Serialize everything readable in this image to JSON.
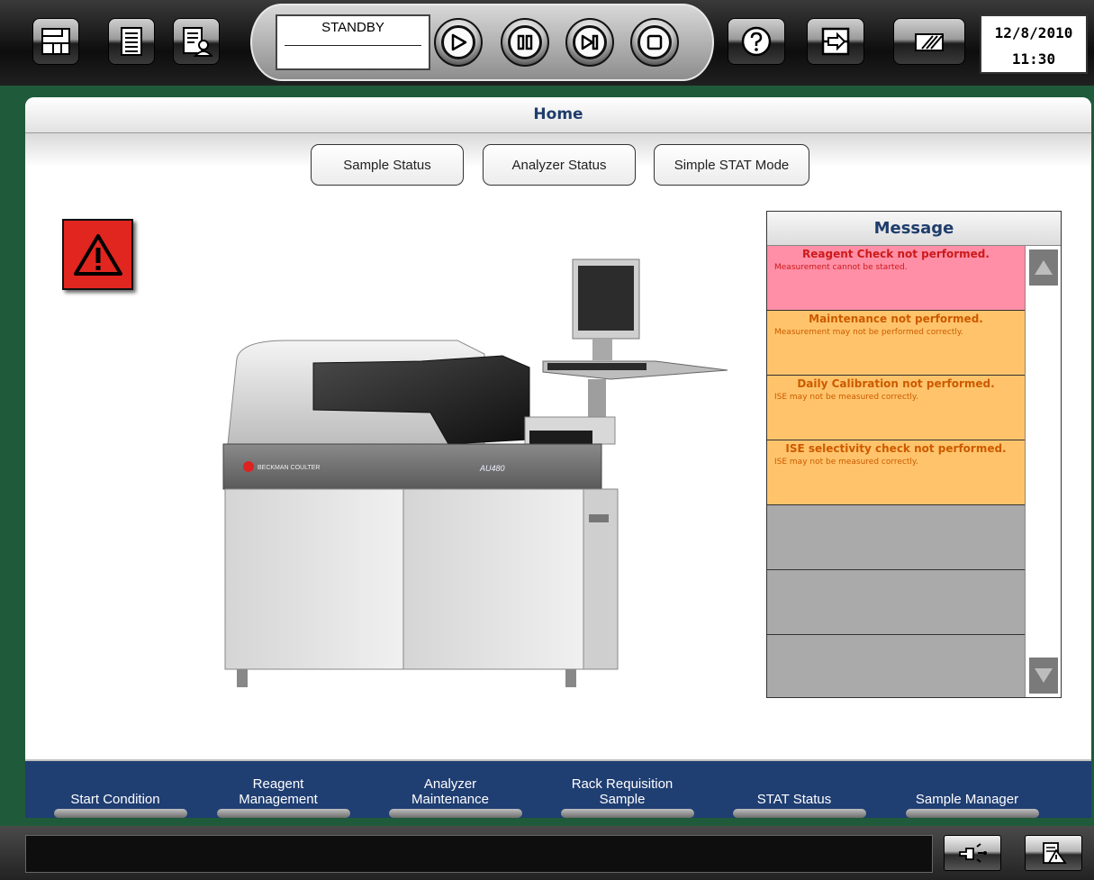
{
  "toolbar": {
    "left_icons": [
      "menu-icon",
      "list-icon",
      "user-report-icon"
    ],
    "status_text": "STANDBY",
    "status_subtext": "",
    "play_buttons": [
      "play-icon",
      "pause-icon",
      "step-icon",
      "stop-icon"
    ],
    "right_icons": [
      "help-icon",
      "exit-icon",
      "printer-icon"
    ],
    "date": "12/8/2010",
    "time": "11:30"
  },
  "page": {
    "title": "Home",
    "sub_buttons": [
      "Sample Status",
      "Analyzer Status",
      "Simple STAT Mode"
    ]
  },
  "analyzer": {
    "brand": "BECKMAN COULTER",
    "model": "AU480"
  },
  "messages": {
    "title": "Message",
    "items": [
      {
        "title": "Reagent Check not performed.",
        "detail": "Measurement cannot be started.",
        "level": "error"
      },
      {
        "title": "Maintenance not performed.",
        "detail": "Measurement may not be performed correctly.",
        "level": "warning"
      },
      {
        "title": "Daily Calibration not performed.",
        "detail": "ISE may not be measured correctly.",
        "level": "warning"
      },
      {
        "title": "ISE selectivity check not performed.",
        "detail": "ISE may not be measured correctly.",
        "level": "warning"
      }
    ]
  },
  "bottom_nav": [
    "Start Condition",
    "Reagent\nManagement",
    "Analyzer\nMaintenance",
    "Rack Requisition\nSample",
    "STAT Status",
    "Sample Manager"
  ],
  "statusbar": {
    "message": "",
    "icons": [
      "alarm-buzzer-icon",
      "error-log-icon"
    ]
  },
  "colors": {
    "frame_green": "#1f5a3a",
    "nav_blue": "#1f3e72",
    "title_blue": "#1f3d6b",
    "error_bg": "#ff8fa6",
    "warning_bg": "#ffc46b",
    "error_text": "#cc1a1a",
    "warning_text": "#cc5a00",
    "alert_red": "#e0261e"
  }
}
